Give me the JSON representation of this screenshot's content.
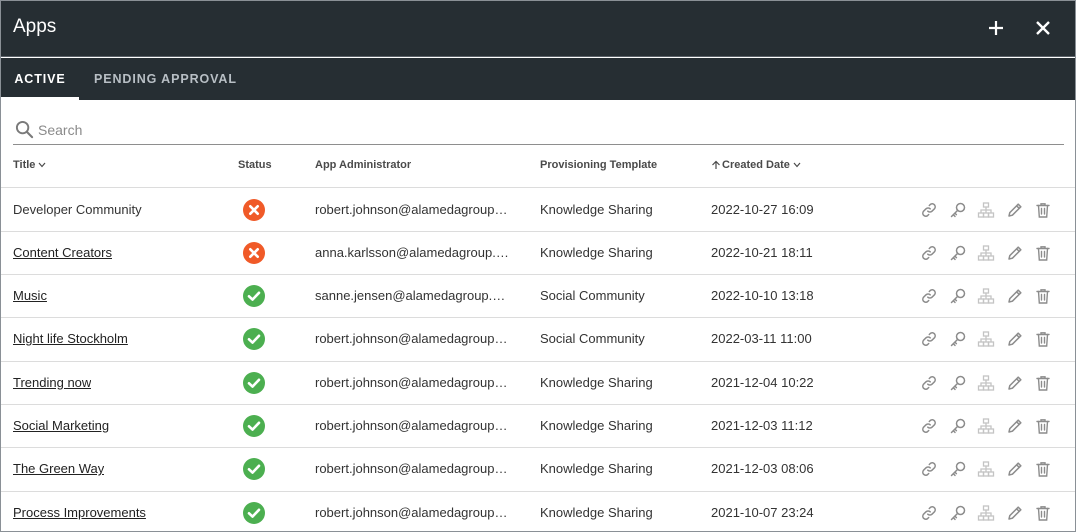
{
  "window": {
    "title": "Apps"
  },
  "tabs": [
    {
      "label": "ACTIVE"
    },
    {
      "label": "PENDING APPROVAL"
    }
  ],
  "search": {
    "placeholder": "Search",
    "value": ""
  },
  "columns": {
    "title": "Title",
    "status": "Status",
    "admin": "App Administrator",
    "template": "Provisioning Template",
    "created": "Created Date"
  },
  "rows": [
    {
      "title": "Developer Community",
      "linked": false,
      "status": "error",
      "admin": "robert.johnson@alamedagroup.o...",
      "template": "Knowledge Sharing",
      "created": "2022-10-27 16:09"
    },
    {
      "title": "Content Creators",
      "linked": true,
      "status": "error",
      "admin": "anna.karlsson@alamedagroup.o...",
      "template": "Knowledge Sharing",
      "created": "2022-10-21 18:11"
    },
    {
      "title": "Music",
      "linked": true,
      "status": "ok",
      "admin": "sanne.jensen@alamedagroup.on...",
      "template": "Social Community",
      "created": "2022-10-10 13:18"
    },
    {
      "title": "Night life Stockholm",
      "linked": true,
      "status": "ok",
      "admin": "robert.johnson@alamedagroup.o...",
      "template": "Social Community",
      "created": "2022-03-11 11:00"
    },
    {
      "title": "Trending now",
      "linked": true,
      "status": "ok",
      "admin": "robert.johnson@alamedagroup.o...",
      "template": "Knowledge Sharing",
      "created": "2021-12-04 10:22"
    },
    {
      "title": "Social Marketing",
      "linked": true,
      "status": "ok",
      "admin": "robert.johnson@alamedagroup.o...",
      "template": "Knowledge Sharing",
      "created": "2021-12-03 11:12"
    },
    {
      "title": "The Green Way",
      "linked": true,
      "status": "ok",
      "admin": "robert.johnson@alamedagroup.o...",
      "template": "Knowledge Sharing",
      "created": "2021-12-03 08:06"
    },
    {
      "title": "Process Improvements",
      "linked": true,
      "status": "ok",
      "admin": "robert.johnson@alamedagroup.o...",
      "template": "Knowledge Sharing",
      "created": "2021-10-07 23:24"
    }
  ],
  "icons": {
    "add": "plus-icon",
    "close": "close-icon",
    "search": "search-icon",
    "status_ok": "check-circle-icon",
    "status_error": "x-circle-icon",
    "row_actions": [
      "link-icon",
      "key-icon",
      "hierarchy-icon",
      "pencil-icon",
      "trash-icon"
    ]
  },
  "colors": {
    "header_bg": "#262e33",
    "status_ok": "#4caf50",
    "status_error": "#f05a28",
    "action_icon": "#8c8c8c",
    "action_icon_disabled": "#c4c4c4"
  }
}
